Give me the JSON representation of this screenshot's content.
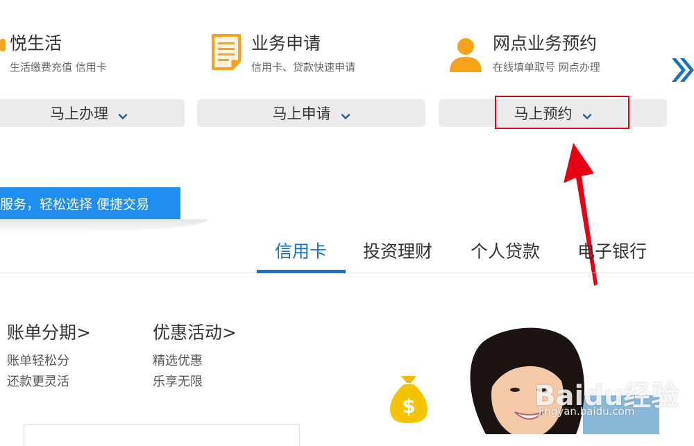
{
  "services": [
    {
      "title": "悦生活",
      "subtitle": "生活缴费充值 信用卡",
      "button": "马上办理",
      "icon": "life-icon"
    },
    {
      "title": "业务申请",
      "subtitle": "信用卡、贷款快速申请",
      "button": "马上申请",
      "icon": "document-icon"
    },
    {
      "title": "网点业务预约",
      "subtitle": "在线填单取号 网点办理",
      "button": "马上预约",
      "icon": "person-icon"
    }
  ],
  "banner": {
    "text": "服务，轻松选择 便捷交易"
  },
  "tabs": [
    {
      "label": "信用卡",
      "active": true
    },
    {
      "label": "投资理财",
      "active": false
    },
    {
      "label": "个人贷款",
      "active": false
    },
    {
      "label": "电子银行",
      "active": false
    }
  ],
  "sections": [
    {
      "title": "账单分期>",
      "line1": "账单轻松分",
      "line2": "还款更灵活"
    },
    {
      "title": "优惠活动>",
      "line1": "精选优惠",
      "line2": "乐享无限"
    }
  ],
  "watermark": {
    "brand": "Baidu经验",
    "url": "jingyan.baidu.com"
  },
  "colors": {
    "accent": "#1a6fc1",
    "banner": "#1f8ef1",
    "highlight": "#e60012",
    "icon_orange": "#f7a21b",
    "button_bg": "#ebebeb"
  }
}
